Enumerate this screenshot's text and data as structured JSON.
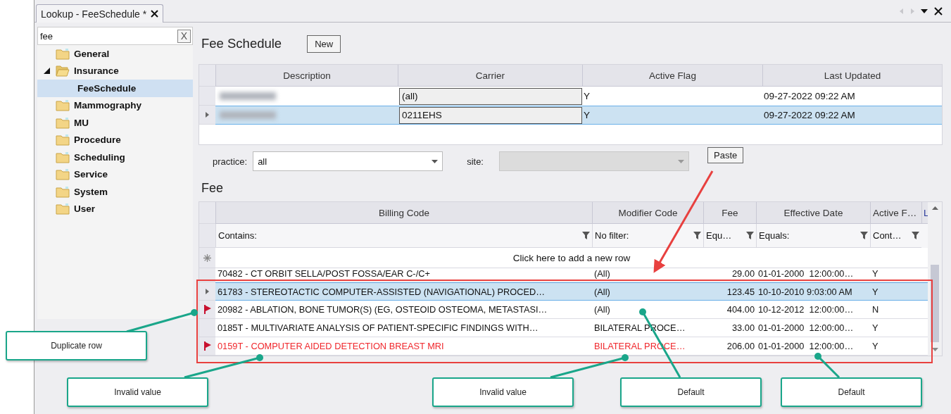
{
  "tab": {
    "title": "Lookup - FeeSchedule *"
  },
  "sidebar": {
    "search": {
      "value": "fee"
    },
    "clear_button": "X",
    "tree": [
      {
        "label": "General",
        "expanded": false,
        "selected": false
      },
      {
        "label": "Insurance",
        "expanded": true,
        "selected": false,
        "children": [
          {
            "label": "FeeSchedule",
            "selected": true
          }
        ]
      },
      {
        "label": "Mammography",
        "expanded": false,
        "selected": false
      },
      {
        "label": "MU",
        "expanded": false,
        "selected": false
      },
      {
        "label": "Procedure",
        "expanded": false,
        "selected": false
      },
      {
        "label": "Scheduling",
        "expanded": false,
        "selected": false
      },
      {
        "label": "Service",
        "expanded": false,
        "selected": false
      },
      {
        "label": "System",
        "expanded": false,
        "selected": false
      },
      {
        "label": "User",
        "expanded": false,
        "selected": false
      }
    ]
  },
  "fee_schedule": {
    "title": "Fee Schedule",
    "new_button": "New",
    "columns": [
      "Description",
      "Carrier",
      "Active Flag",
      "Last Updated"
    ],
    "rows": [
      {
        "description_redacted": true,
        "carrier": "(all)",
        "active_flag": "Y",
        "last_updated": "09-27-2022 09:22 AM",
        "selected": false
      },
      {
        "description_redacted": true,
        "carrier": "0211EHS",
        "active_flag": "Y",
        "last_updated": "09-27-2022 09:22 AM",
        "selected": true
      }
    ]
  },
  "filters": {
    "practice_label": "practice:",
    "practice_value": "all",
    "site_label": "site:",
    "site_disabled": true,
    "paste_button": "Paste"
  },
  "fee": {
    "title": "Fee",
    "columns": [
      "Billing Code",
      "Modifier Code",
      "Fee",
      "Effective Date",
      "Active F…",
      "L"
    ],
    "filters": [
      "Contains:",
      "No filter:",
      "Equ…",
      "Equals:",
      "Cont…"
    ],
    "new_row_text": "Click here to add a new row",
    "rows": [
      {
        "billing_code": "70482 - CT ORBIT SELLA/POST FOSSA/EAR C-/C+",
        "modifier_code": "(All)",
        "fee": "29.00",
        "effective_date": "01-01-2000  12:00:00…",
        "active_flag": "Y",
        "selected": false,
        "flagged": false,
        "invalid": false
      },
      {
        "billing_code": "61783 - STEREOTACTIC COMPUTER-ASSISTED (NAVIGATIONAL) PROCED…",
        "modifier_code": "(All)",
        "fee": "123.45",
        "effective_date": "10-10-2010 9:03:00 AM",
        "active_flag": "Y",
        "selected": true,
        "flagged": false,
        "invalid": false
      },
      {
        "billing_code": "20982 - ABLATION, BONE TUMOR(S) (EG, OSTEOID OSTEOMA, METASTASI…",
        "modifier_code": "(All)",
        "fee": "404.00",
        "effective_date": "10-12-2012  12:00:00…",
        "active_flag": "N",
        "selected": false,
        "flagged": true,
        "invalid": false
      },
      {
        "billing_code": "0185T - MULTIVARIATE ANALYSIS OF PATIENT-SPECIFIC FINDINGS WITH…",
        "modifier_code": "BILATERAL PROCE…",
        "fee": "33.00",
        "effective_date": "01-01-2000  12:00:00…",
        "active_flag": "Y",
        "selected": false,
        "flagged": false,
        "invalid": false
      },
      {
        "billing_code": "0159T - COMPUTER AIDED DETECTION BREAST MRI",
        "modifier_code": "BILATERAL PROCE…",
        "fee": "206.00",
        "effective_date": "01-01-2000  12:00:00…",
        "active_flag": "Y",
        "selected": false,
        "flagged": true,
        "invalid": true
      }
    ]
  },
  "callouts": [
    {
      "text": "Duplicate row"
    },
    {
      "text": "Invalid value"
    },
    {
      "text": "Invalid value"
    },
    {
      "text": "Default"
    },
    {
      "text": "Default"
    }
  ]
}
